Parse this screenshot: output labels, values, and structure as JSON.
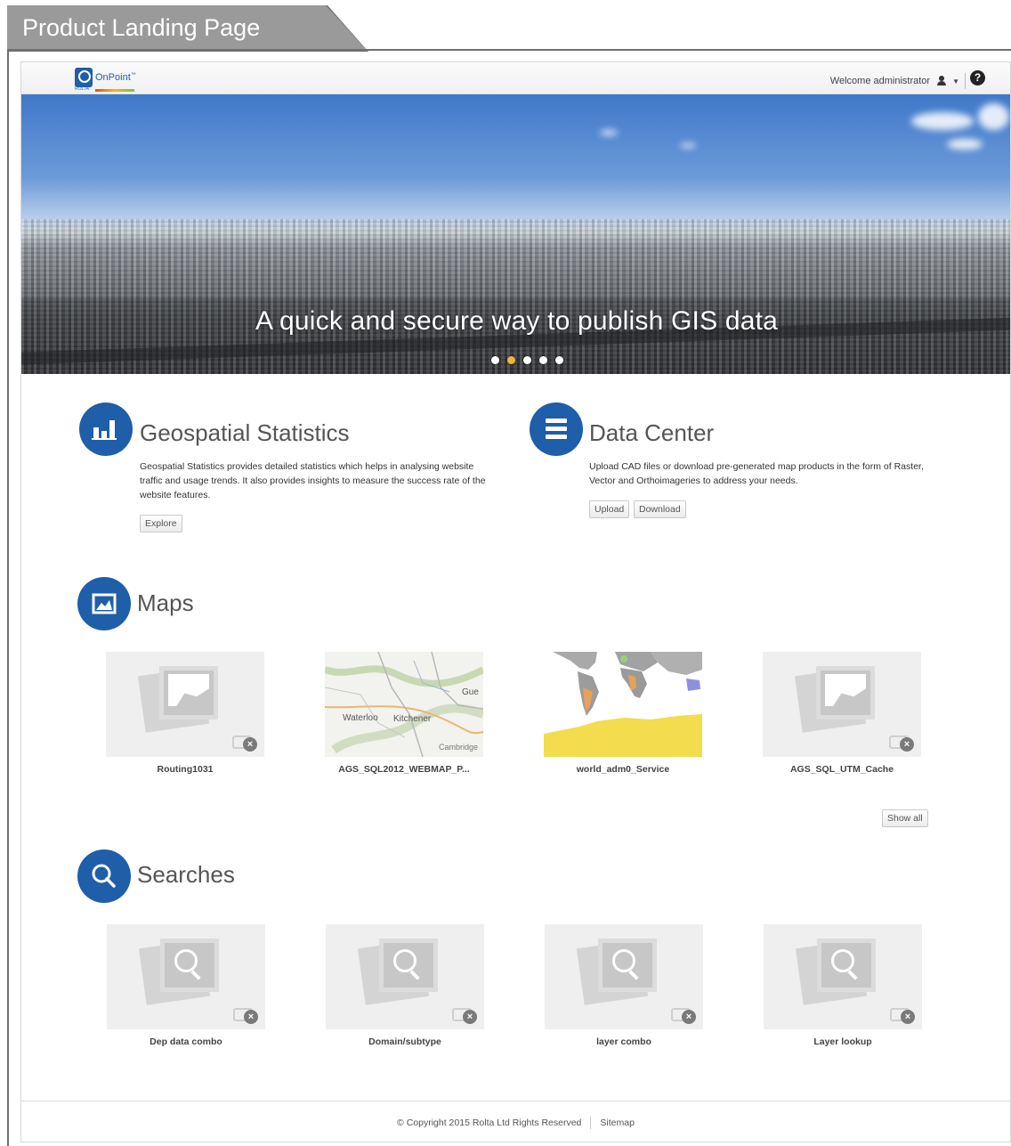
{
  "page_label": "Product Landing Page",
  "header": {
    "logo_text": "OnPoint",
    "logo_trademark": "™",
    "logo_sub": "ROLTA",
    "welcome_text": "Welcome administrator",
    "help_glyph": "?"
  },
  "hero": {
    "caption": "A quick and secure way to publish GIS data",
    "dots": 5,
    "active_dot": 2
  },
  "geospatial": {
    "title": "Geospatial Statistics",
    "description": "Geospatial Statistics provides detailed statistics which helps in analysing website traffic and usage trends. It also provides insights to measure the success rate of the website features.",
    "explore_label": "Explore",
    "icon": "bar-chart-icon"
  },
  "data_center": {
    "title": "Data Center",
    "description": "Upload CAD files or download pre-generated map products in the form of Raster, Vector and Orthoimageries to address your needs.",
    "upload_label": "Upload",
    "download_label": "Download",
    "icon": "list-icon"
  },
  "maps": {
    "title": "Maps",
    "icon": "map-icon",
    "items": [
      {
        "label": "Routing1031"
      },
      {
        "label": "AGS_SQL2012_WEBMAP_P..."
      },
      {
        "label": "world_adm0_Service"
      },
      {
        "label": "AGS_SQL_UTM_Cache"
      }
    ],
    "kitchener_labels": {
      "gue": "Gue",
      "waterloo": "Waterloo",
      "kitchener": "Kitchener",
      "cambridge": "Cambridge"
    },
    "show_all_label": "Show all"
  },
  "searches": {
    "title": "Searches",
    "icon": "search-icon",
    "items": [
      {
        "label": "Dep data combo"
      },
      {
        "label": "Domain/subtype"
      },
      {
        "label": "layer combo"
      },
      {
        "label": "Layer lookup"
      }
    ]
  },
  "footer": {
    "copyright": "© Copyright 2015 Rolta Ltd Rights Reserved",
    "sitemap_label": "Sitemap"
  },
  "colors": {
    "brand_blue": "#1f5ea8",
    "active_dot": "#f0b43a"
  }
}
